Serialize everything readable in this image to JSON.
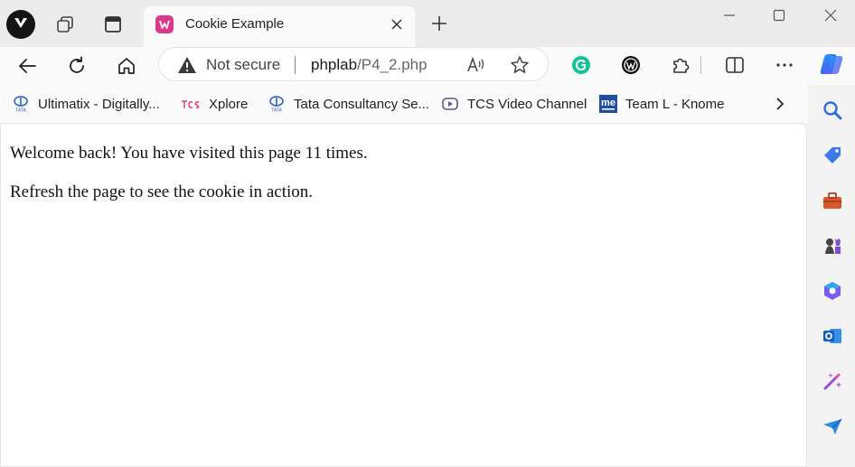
{
  "tab": {
    "title": "Cookie Example"
  },
  "address_bar": {
    "security_text": "Not secure",
    "host": "phplab",
    "path": "/P4_2.php"
  },
  "bookmarks": [
    {
      "label": "Ultimatix - Digitally...",
      "icon": "tata-icon"
    },
    {
      "label": "Xplore",
      "icon": "tcs-icon"
    },
    {
      "label": "Tata Consultancy Se...",
      "icon": "tata-icon"
    },
    {
      "label": "TCS Video Channel",
      "icon": "video-icon"
    },
    {
      "label": "Team L - Knome",
      "icon": "knome-icon"
    }
  ],
  "page": {
    "line1": "Welcome back! You have visited this page 11 times.",
    "line2": "Refresh the page to see the cookie in action."
  },
  "colors": {
    "accent": "#e0378e",
    "sidebar_bg": "#f3f3f3"
  }
}
